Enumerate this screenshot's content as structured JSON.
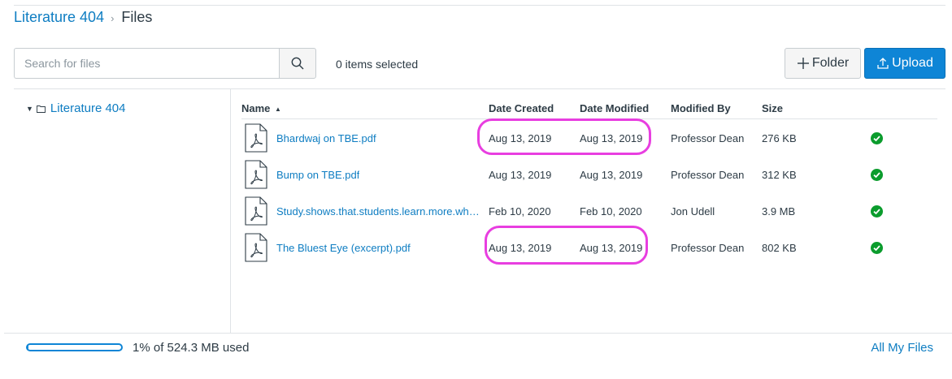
{
  "breadcrumb": {
    "course": "Literature 404",
    "separator": "›",
    "current": "Files"
  },
  "search": {
    "placeholder": "Search for files"
  },
  "selection": {
    "label": "0 items selected"
  },
  "buttons": {
    "folder": "Folder",
    "upload": "Upload"
  },
  "tree": {
    "root": "Literature 404"
  },
  "table": {
    "headers": {
      "name": "Name",
      "sort_indicator": "▲",
      "created": "Date Created",
      "modified": "Date Modified",
      "modified_by": "Modified By",
      "size": "Size"
    },
    "rows": [
      {
        "name": "Bhardwaj on TBE.pdf",
        "created": "Aug 13, 2019",
        "modified": "Aug 13, 2019",
        "modified_by": "Professor Dean",
        "size": "276 KB",
        "icon": "pdf-file-icon",
        "status": "published"
      },
      {
        "name": "Bump on TBE.pdf",
        "created": "Aug 13, 2019",
        "modified": "Aug 13, 2019",
        "modified_by": "Professor Dean",
        "size": "312 KB",
        "icon": "pdf-file-icon",
        "status": "published"
      },
      {
        "name": "Study.shows.that.students.learn.more.whe...",
        "created": "Feb 10, 2020",
        "modified": "Feb 10, 2020",
        "modified_by": "Jon Udell",
        "size": "3.9 MB",
        "icon": "pdf-file-icon",
        "status": "published"
      },
      {
        "name": "The Bluest Eye (excerpt).pdf",
        "created": "Aug 13, 2019",
        "modified": "Aug 13, 2019",
        "modified_by": "Professor Dean",
        "size": "802 KB",
        "icon": "pdf-file-icon",
        "status": "published"
      }
    ]
  },
  "quota": {
    "label": "1% of 524.3 MB used",
    "percent": 1
  },
  "footer": {
    "all_files": "All My Files"
  },
  "colors": {
    "link": "#0e7dc2",
    "primary": "#0e85d6",
    "success": "#0b9c2d",
    "annotation": "#e83ee0"
  }
}
